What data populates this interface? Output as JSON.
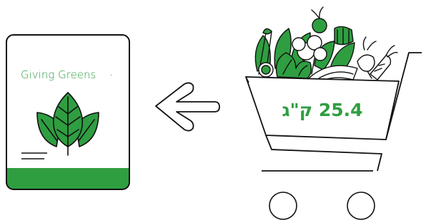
{
  "brand": {
    "name": "Giving Greens",
    "mark": "™",
    "color": "#2f9e41"
  },
  "cart": {
    "weight_label": "25.4 ק\"ג",
    "label_color": "#2f9e41"
  },
  "icons": {
    "package": "package-icon",
    "leaf": "leaf-icon",
    "arrow": "arrow-left-icon",
    "cart": "shopping-cart-icon",
    "vegetables": "vegetables-icon"
  },
  "colors": {
    "green": "#2f9e41",
    "outline": "#111111",
    "background": "#ffffff"
  }
}
